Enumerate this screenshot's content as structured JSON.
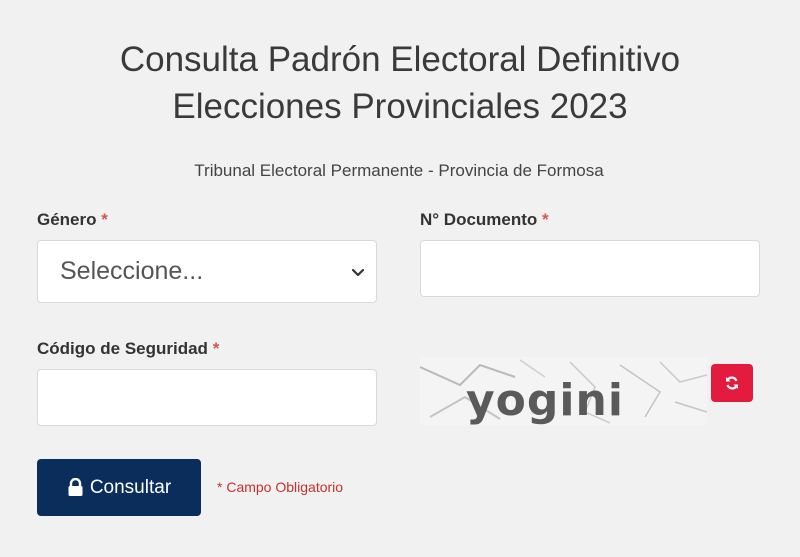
{
  "header": {
    "title_line1": "Consulta Padrón Electoral Definitivo",
    "title_line2": "Elecciones Provinciales 2023",
    "subtitle": "Tribunal Electoral Permanente - Provincia de Formosa"
  },
  "form": {
    "genero": {
      "label": "Género",
      "required_mark": "*",
      "selected_value": "Seleccione..."
    },
    "documento": {
      "label": "N° Documento",
      "required_mark": "*",
      "value": ""
    },
    "codigo": {
      "label": "Código de Seguridad",
      "required_mark": "*",
      "value": ""
    },
    "captcha": {
      "text": "yogini",
      "refresh_icon": "refresh-icon"
    },
    "submit": {
      "label": "Consultar",
      "icon": "lock-icon"
    },
    "required_note": "* Campo Obligatorio"
  },
  "colors": {
    "background": "#f1f1f1",
    "primary_button": "#0b2d5c",
    "refresh_button": "#e31b3f",
    "required": "#d9534f"
  }
}
